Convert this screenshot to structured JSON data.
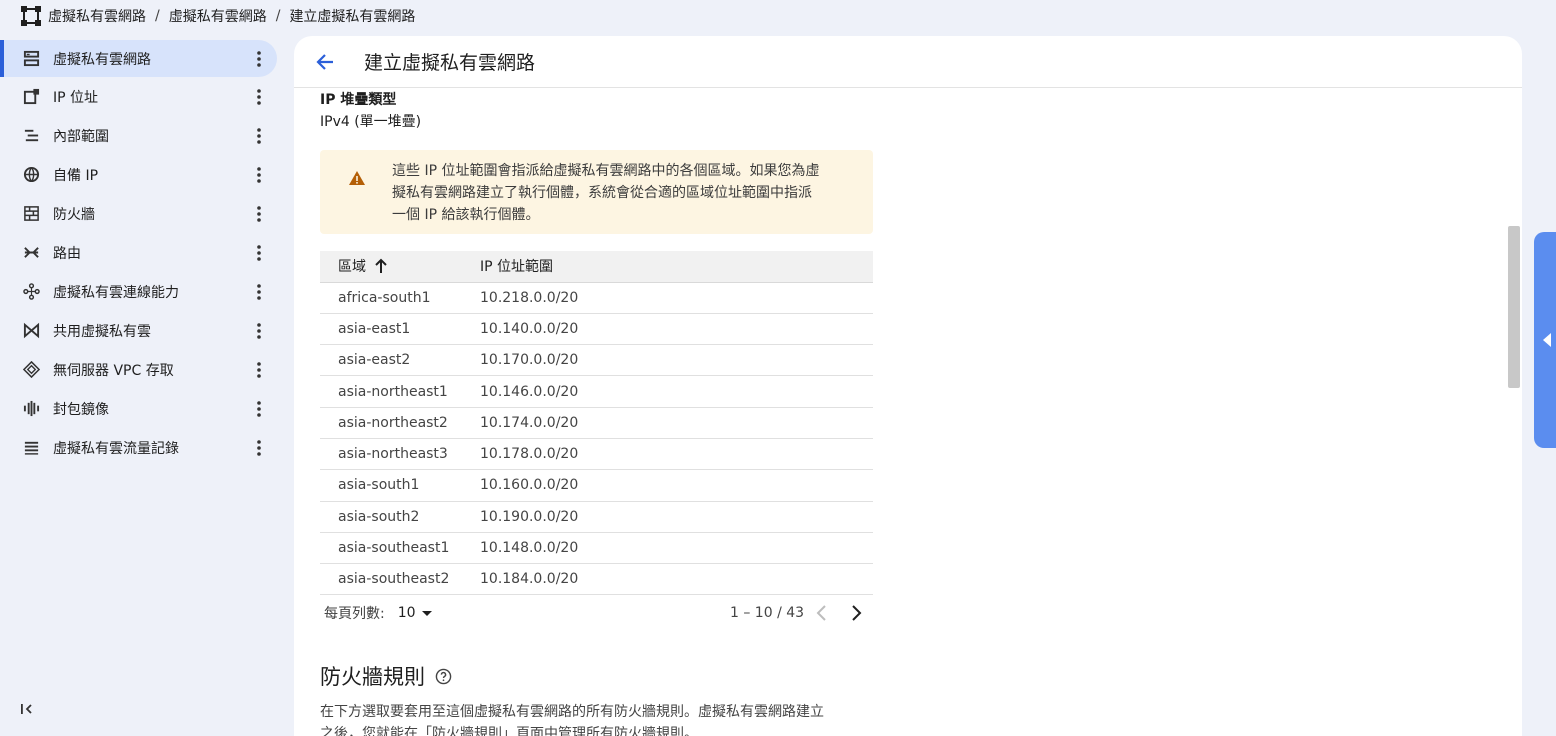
{
  "breadcrumb": {
    "items": [
      "虛擬私有雲網路",
      "虛擬私有雲網路",
      "建立虛擬私有雲網路"
    ],
    "separator": "/"
  },
  "sidebar": {
    "items": [
      {
        "label": "虛擬私有雲網路",
        "icon": "vpc-network-icon",
        "active": true
      },
      {
        "label": "IP 位址",
        "icon": "ip-address-icon"
      },
      {
        "label": "內部範圍",
        "icon": "internal-range-icon"
      },
      {
        "label": "自備 IP",
        "icon": "globe-icon"
      },
      {
        "label": "防火牆",
        "icon": "firewall-icon"
      },
      {
        "label": "路由",
        "icon": "routes-icon"
      },
      {
        "label": "虛擬私有雲連線能力",
        "icon": "connectivity-icon"
      },
      {
        "label": "共用虛擬私有雲",
        "icon": "shared-vpc-icon"
      },
      {
        "label": "無伺服器 VPC 存取",
        "icon": "serverless-icon"
      },
      {
        "label": "封包鏡像",
        "icon": "packet-mirroring-icon"
      },
      {
        "label": "虛擬私有雲流量記錄",
        "icon": "flow-logs-icon"
      }
    ]
  },
  "header": {
    "title": "建立虛擬私有雲網路"
  },
  "ip_stack": {
    "label": "IP 堆疊類型",
    "value": "IPv4 (單一堆疊)"
  },
  "warning": {
    "lines": [
      "這些 IP 位址範圍會指派給虛擬私有雲網路中的各個區域。如果您為虛",
      "擬私有雲網路建立了執行個體，系統會從合適的區域位址範圍中指派",
      "一個 IP 給該執行個體。"
    ]
  },
  "table": {
    "columns": [
      "區域",
      "IP 位址範圍"
    ],
    "rows": [
      [
        "africa-south1",
        "10.218.0.0/20"
      ],
      [
        "asia-east1",
        "10.140.0.0/20"
      ],
      [
        "asia-east2",
        "10.170.0.0/20"
      ],
      [
        "asia-northeast1",
        "10.146.0.0/20"
      ],
      [
        "asia-northeast2",
        "10.174.0.0/20"
      ],
      [
        "asia-northeast3",
        "10.178.0.0/20"
      ],
      [
        "asia-south1",
        "10.160.0.0/20"
      ],
      [
        "asia-south2",
        "10.190.0.0/20"
      ],
      [
        "asia-southeast1",
        "10.148.0.0/20"
      ],
      [
        "asia-southeast2",
        "10.184.0.0/20"
      ]
    ]
  },
  "pager": {
    "rows_label": "每頁列數:",
    "rows_value": "10",
    "range": "1 – 10 / 43"
  },
  "firewall": {
    "title": "防火牆規則",
    "desc_lines": [
      "在下方選取要套用至這個虛擬私有雲網路的所有防火牆規則。虛擬私有雲網路建立",
      "之後，您就能在「防火牆規則」頁面中管理所有防火牆規則。"
    ]
  },
  "colors": {
    "accent": "#2b5fd9",
    "active_bg": "#d7e3fb",
    "warning_bg": "#fdf5e2",
    "warning_icon": "#b45f06"
  }
}
